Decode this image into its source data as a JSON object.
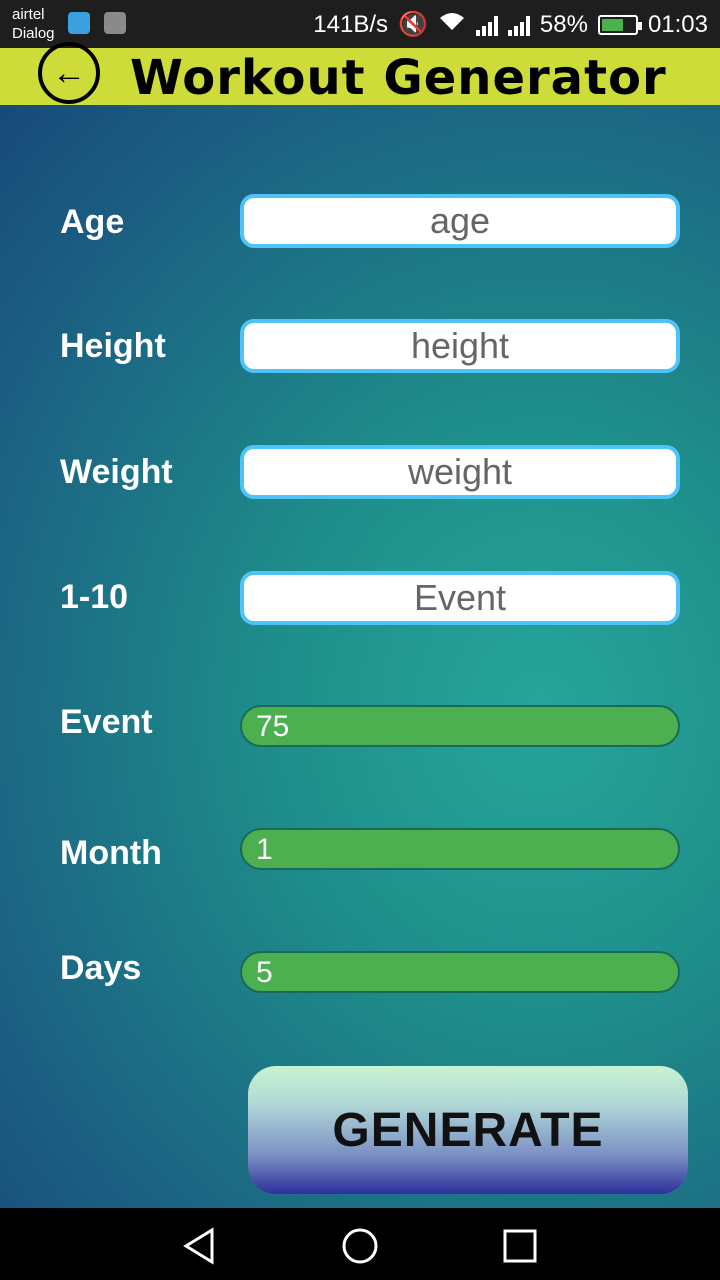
{
  "status_bar": {
    "carrier_line1": "airtel",
    "carrier_line2": "Dialog",
    "speed": "141B/s",
    "battery": "58%",
    "time": "01:03"
  },
  "header": {
    "title": "Workout Generator",
    "back_icon": "arrow-left-circle-icon",
    "background": "#cddc39"
  },
  "form": {
    "age": {
      "label": "Age",
      "placeholder": "age"
    },
    "height": {
      "label": "Height",
      "placeholder": "height"
    },
    "weight": {
      "label": "Weight",
      "placeholder": "weight"
    },
    "event_rank": {
      "label": "1-10",
      "placeholder": "Event"
    },
    "event": {
      "label": "Event",
      "value": "75"
    },
    "month": {
      "label": "Month",
      "value": "1"
    },
    "days": {
      "label": "Days",
      "value": "5"
    }
  },
  "generate_label": "GENERATE",
  "colors": {
    "accent_border": "#4fc3f7",
    "progress": "#4caf50"
  }
}
